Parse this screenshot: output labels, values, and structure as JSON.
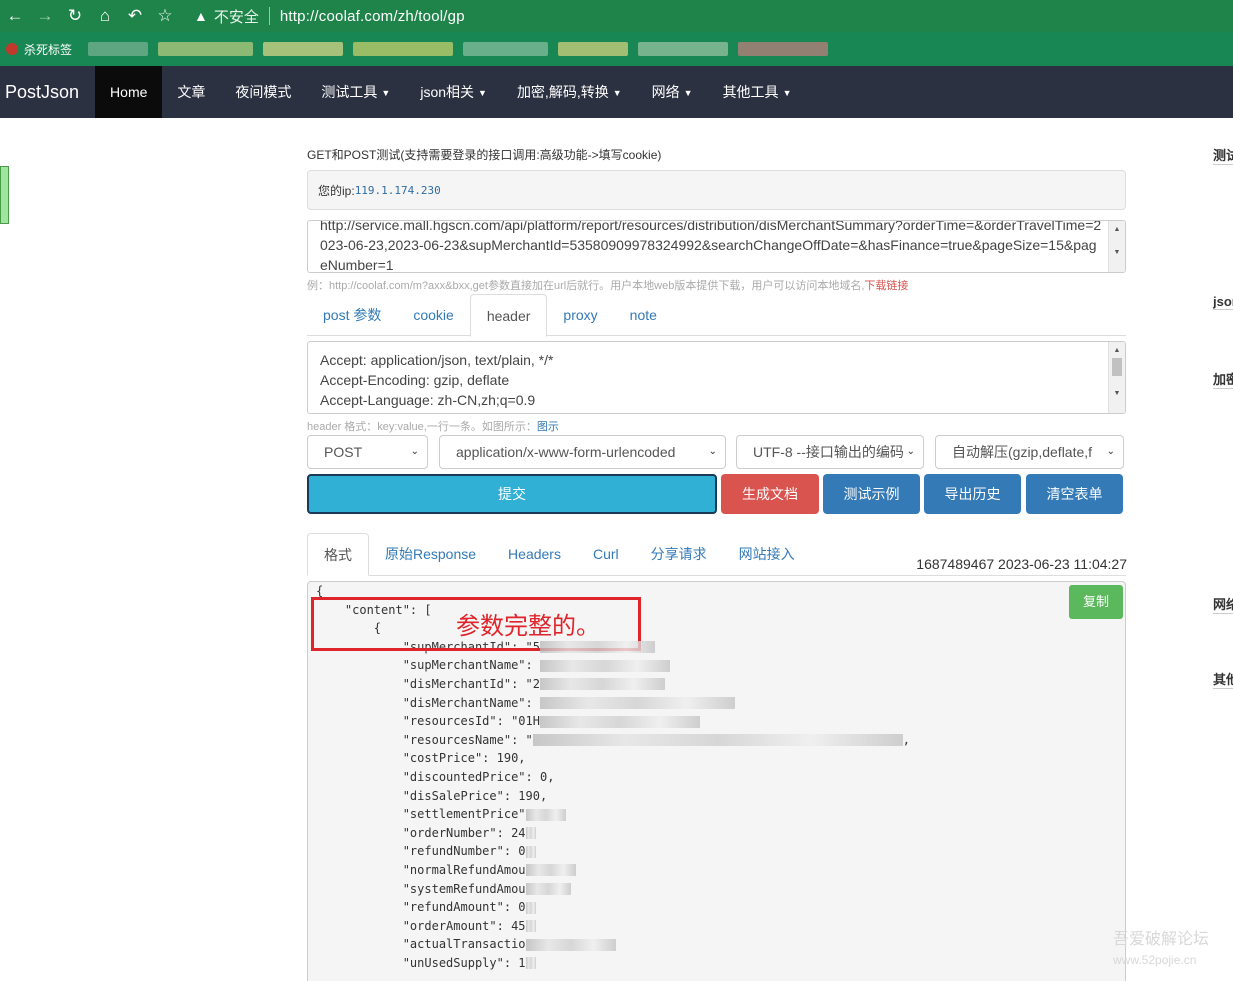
{
  "browser": {
    "insecure_label": "不安全",
    "url": "http://coolaf.com/zh/tool/gp",
    "bookmark_first": "杀死标签"
  },
  "navbar": {
    "brand": "PostJson",
    "items": [
      {
        "label": "Home"
      },
      {
        "label": "文章"
      },
      {
        "label": "夜间模式"
      },
      {
        "label": "测试工具"
      },
      {
        "label": "json相关"
      },
      {
        "label": "加密,解码,转换"
      },
      {
        "label": "网络"
      },
      {
        "label": "其他工具"
      }
    ]
  },
  "right_labels": [
    "测试",
    "json",
    "加密",
    "网络",
    "其他"
  ],
  "main": {
    "title": "GET和POST测试(支持需要登录的接口调用:高级功能->填写cookie)",
    "ip_label": "您的ip:",
    "ip_value": "119.1.174.230",
    "url_text": "http://service.mall.hgscn.com/api/platform/report/resources/distribution/disMerchantSummary?orderTime=&orderTravelTime=2023-06-23,2023-06-23&supMerchantId=53580909978324992&searchChangeOffDate=&hasFinance=true&pageSize=15&pageNumber=1",
    "hint_text": "例：http://coolaf.com/m?axx&bxx,get参数直接加在url后就行。用户本地web版本提供下载，用户可以访问本地域名,",
    "hint_download": "下载链接",
    "request_tabs": [
      "post 参数",
      "cookie",
      "header",
      "proxy",
      "note"
    ],
    "header_lines": [
      "Accept: application/json, text/plain, */*",
      "Accept-Encoding: gzip, deflate",
      "Accept-Language: zh-CN,zh;q=0.9"
    ],
    "header_hint": "header 格式：key:value,一行一条。如图所示：",
    "header_hint_link": "图示",
    "selects": {
      "method": "POST",
      "content_type": "application/x-www-form-urlencoded",
      "encoding": "UTF-8 --接口输出的编码",
      "decompress": "自动解压(gzip,deflate,f"
    },
    "buttons": {
      "submit": "提交",
      "generate_doc": "生成文档",
      "test_example": "测试示例",
      "export_history": "导出历史",
      "clear_form": "清空表单"
    },
    "result_tabs": [
      "格式",
      "原始Response",
      "Headers",
      "Curl",
      "分享请求",
      "网站接入"
    ],
    "timestamp": "1687489467 2023-06-23 11:04:27",
    "copy_label": "复制",
    "annotation": "参数完整的。",
    "json_lines": [
      "{",
      "    \"content\": [",
      "        {",
      "            \"supMerchantId\": \"5",
      "            \"supMerchantName\": ",
      "            \"disMerchantId\": \"2",
      "            \"disMerchantName\": ",
      "            \"resourcesId\": \"01H",
      "            \"resourcesName\": \"",
      "            \"costPrice\": 190,",
      "            \"discountedPrice\": 0,",
      "            \"disSalePrice\": 190,",
      "            \"settlementPrice\"",
      "            \"orderNumber\": 24",
      "            \"refundNumber\": 0",
      "            \"normalRefundAmou",
      "            \"systemRefundAmou",
      "            \"refundAmount\": 0",
      "            \"orderAmount\": 45",
      "            \"actualTransactio",
      "            \"unUsedSupply\": 1"
    ]
  },
  "watermark": {
    "line1": "吾爱破解论坛",
    "line2": "www.52pojie.cn"
  }
}
